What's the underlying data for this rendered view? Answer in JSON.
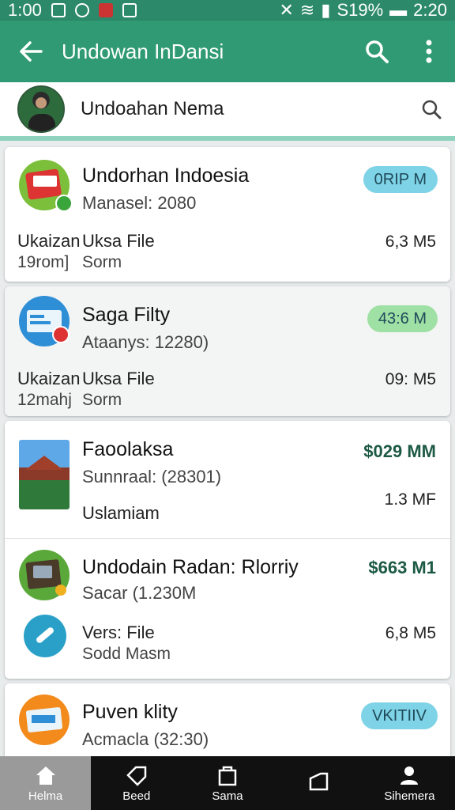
{
  "statusbar": {
    "time_left": "1:00",
    "battery": "S19%",
    "time_right": "2:20"
  },
  "appbar": {
    "title": "Undowan InDansi"
  },
  "search": {
    "label": "Undoahan Nema"
  },
  "items": [
    {
      "name": "Undorhan Indoesia",
      "sub": "Manasel: 2080",
      "badge": "0RIP M",
      "line1_a": "Ukaizan",
      "line1_b": "Uksa File",
      "line2_a": "19rom]",
      "line2_b": "Sorm",
      "size": "6,3 M5",
      "badge_color": "#7fd3e6"
    },
    {
      "name": "Saga Filty",
      "sub": "Ataanys: 12280)",
      "badge": "43:6 M",
      "line1_a": "Ukaizan",
      "line1_b": "Uksa File",
      "line2_a": "12mahj",
      "line2_b": "Sorm",
      "size": "09: M5",
      "badge_color": "#9fe0a4"
    },
    {
      "name": "Faoolaksa",
      "sub": "Sunnraal: (28301)",
      "price": "$029 MM",
      "extra": "Uslamiam",
      "size": "1.3 MF"
    },
    {
      "name": "Undodain Radan: Rlorriy",
      "sub": "Sacar (1.230M",
      "price": "$663 M1",
      "line1_b": "Vers: File",
      "line2_b": "Sodd Masm",
      "size": "6,8 M5"
    },
    {
      "name": "Puven klity",
      "sub": "Acmacla (32:30)",
      "badge": "VKITIIV",
      "badge_color": "#7fd3e6"
    }
  ],
  "nav": [
    {
      "label": "Helma"
    },
    {
      "label": "Beed"
    },
    {
      "label": "Sama"
    },
    {
      "label": ""
    },
    {
      "label": "Sihemera"
    }
  ]
}
